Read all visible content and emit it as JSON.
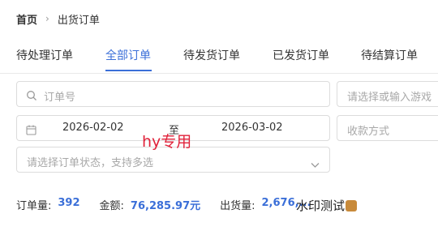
{
  "breadcrumb": {
    "home": "首页",
    "separator": "›",
    "current": "出货订单"
  },
  "tabs": [
    {
      "label": "待处理订单",
      "active": false
    },
    {
      "label": "全部订单",
      "active": true
    },
    {
      "label": "待发货订单",
      "active": false
    },
    {
      "label": "已发货订单",
      "active": false
    },
    {
      "label": "待结算订单",
      "active": false
    }
  ],
  "filters": {
    "order_no_placeholder": "订单号",
    "game_placeholder": "请选择或输入游戏",
    "date_start": "2026-02-02",
    "date_separator": "至",
    "date_end": "2026-03-02",
    "payment_placeholder": "收款方式",
    "status_placeholder": "请选择订单状态，支持多选"
  },
  "overlay": {
    "hy_label": "hy专用",
    "watermark": "水印测试"
  },
  "summary": {
    "order_count_label": "订单量:",
    "order_count": "392",
    "amount_label": "金额:",
    "amount": "76,285.97元",
    "shipped_label": "出货量:",
    "shipped": "2,676,..."
  },
  "colors": {
    "accent": "#3b6fd8",
    "overlay_red": "#e0223a"
  }
}
